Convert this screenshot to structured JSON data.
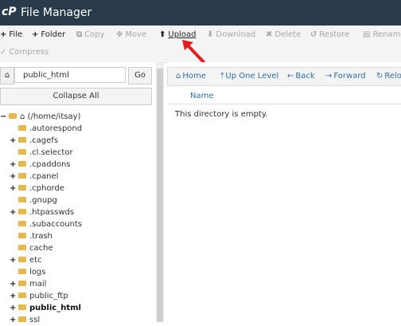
{
  "app": {
    "logo": "cP",
    "title": "File Manager"
  },
  "toolbar": {
    "items": [
      {
        "icon": "+",
        "label": "File",
        "disabled": false
      },
      {
        "icon": "+",
        "label": "Folder",
        "disabled": false
      },
      {
        "icon": "⧉",
        "label": "Copy",
        "disabled": true
      },
      {
        "icon": "✥",
        "label": "Move",
        "disabled": true
      },
      {
        "icon": "⬆",
        "label": "Upload",
        "disabled": false
      },
      {
        "icon": "⬇",
        "label": "Download",
        "disabled": true
      },
      {
        "icon": "✖",
        "label": "Delete",
        "disabled": true
      },
      {
        "icon": "↺",
        "label": "Restore",
        "disabled": true
      },
      {
        "icon": "▤",
        "label": "Rename",
        "disabled": true
      },
      {
        "icon": "✓",
        "label": "Compress",
        "disabled": true
      }
    ]
  },
  "left": {
    "path_value": "public_html",
    "go_label": "Go",
    "collapse_label": "Collapse All",
    "tree": [
      {
        "label": "(/home/itsay)",
        "toggle": "−",
        "home": true
      },
      {
        "label": ".autorespond",
        "toggle": ""
      },
      {
        "label": ".cagefs",
        "toggle": "+"
      },
      {
        "label": ".cl.selector",
        "toggle": ""
      },
      {
        "label": ".cpaddons",
        "toggle": "+"
      },
      {
        "label": ".cpanel",
        "toggle": "+"
      },
      {
        "label": ".cphorde",
        "toggle": "+"
      },
      {
        "label": ".gnupg",
        "toggle": ""
      },
      {
        "label": ".htpasswds",
        "toggle": "+"
      },
      {
        "label": ".subaccounts",
        "toggle": ""
      },
      {
        "label": ".trash",
        "toggle": ""
      },
      {
        "label": "cache",
        "toggle": ""
      },
      {
        "label": "etc",
        "toggle": "+"
      },
      {
        "label": "logs",
        "toggle": ""
      },
      {
        "label": "mail",
        "toggle": "+"
      },
      {
        "label": "public_ftp",
        "toggle": "+"
      },
      {
        "label": "public_html",
        "toggle": "+",
        "bold": true
      },
      {
        "label": "ssl",
        "toggle": "+"
      }
    ]
  },
  "right": {
    "nav": [
      {
        "icon": "⌂",
        "label": "Home"
      },
      {
        "icon": "⤒",
        "label": "Up One Level"
      },
      {
        "icon": "←",
        "label": "Back"
      },
      {
        "icon": "→",
        "label": "Forward"
      },
      {
        "icon": "↻",
        "label": "Relo"
      }
    ],
    "column_name": "Name",
    "empty_message": "This directory is empty."
  }
}
